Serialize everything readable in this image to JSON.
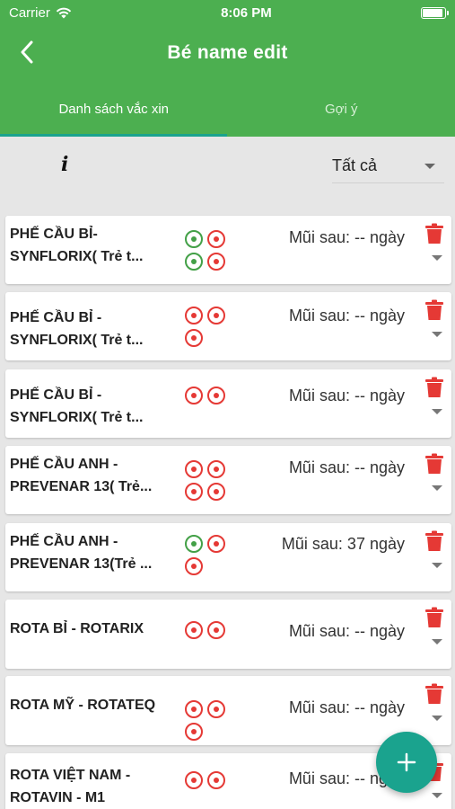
{
  "status_bar": {
    "carrier": "Carrier",
    "time": "8:06 PM"
  },
  "nav": {
    "title": "Bé name edit"
  },
  "tabs": [
    {
      "label": "Danh sách vắc xin",
      "active": true
    },
    {
      "label": "Gợi ý",
      "active": false
    }
  ],
  "filter": {
    "info_label": "i",
    "selected": "Tất cả"
  },
  "vaccines": [
    {
      "name": "PHẾ CẦU BỈ-\nSYNFLORIX( Trẻ t...",
      "dots": [
        "green",
        "red",
        "green",
        "red"
      ],
      "next_dose": "Mũi sau: -- ngày"
    },
    {
      "name": "PHẾ CẦU BỈ -\nSYNFLORIX( Trẻ t...",
      "dots": [
        "red",
        "red",
        "red"
      ],
      "next_dose": "Mũi sau: -- ngày"
    },
    {
      "name": "PHẾ CẦU BỈ -\nSYNFLORIX( Trẻ t...",
      "dots": [
        "red",
        "red"
      ],
      "next_dose": "Mũi sau: -- ngày"
    },
    {
      "name": "PHẾ CẦU ANH -\nPREVENAR 13( Trẻ...",
      "dots": [
        "red",
        "red",
        "red",
        "red"
      ],
      "next_dose": "Mũi sau: -- ngày"
    },
    {
      "name": "PHẾ CẦU ANH -\nPREVENAR 13(Trẻ ...",
      "dots": [
        "green",
        "red",
        "red"
      ],
      "next_dose": "Mũi sau: 37 ngày"
    },
    {
      "name": "ROTA BỈ - ROTARIX",
      "dots": [
        "red",
        "red"
      ],
      "next_dose": "Mũi sau: -- ngày"
    },
    {
      "name": "ROTA MỸ - ROTATEQ",
      "dots": [
        "red",
        "red",
        "red"
      ],
      "next_dose": "Mũi sau: -- ngày"
    },
    {
      "name": "ROTA VIỆT NAM -\nROTAVIN - M1",
      "dots": [
        "red",
        "red"
      ],
      "next_dose": "Mũi sau: -- ngày"
    }
  ],
  "colors": {
    "primary": "#4caf50",
    "accent": "#1aa38e",
    "dot_red": "#e53935",
    "dot_green": "#43a047"
  }
}
